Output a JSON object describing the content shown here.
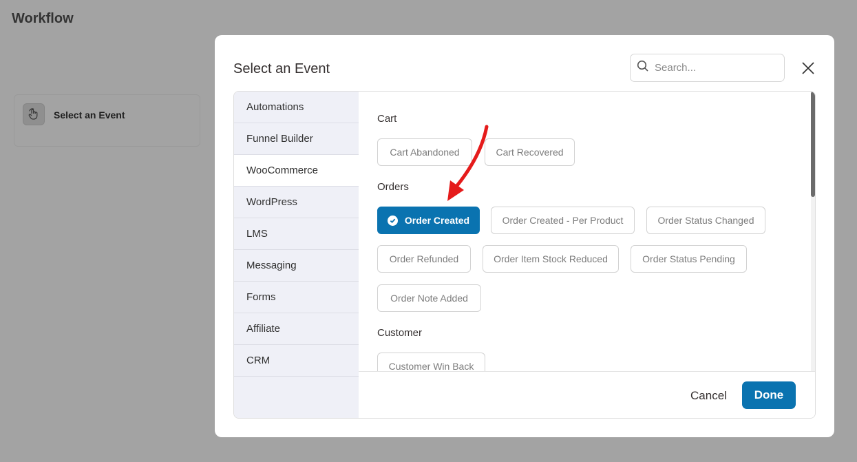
{
  "page": {
    "title": "Workflow"
  },
  "event_card": {
    "label": "Select an Event",
    "icon": "hand-pointer-icon"
  },
  "modal": {
    "title": "Select an Event",
    "search": {
      "placeholder": "Search...",
      "value": ""
    },
    "close_icon": "close-icon"
  },
  "sidebar": {
    "items": [
      {
        "label": "Automations",
        "active": false
      },
      {
        "label": "Funnel Builder",
        "active": false
      },
      {
        "label": "WooCommerce",
        "active": true
      },
      {
        "label": "WordPress",
        "active": false
      },
      {
        "label": "LMS",
        "active": false
      },
      {
        "label": "Messaging",
        "active": false
      },
      {
        "label": "Forms",
        "active": false
      },
      {
        "label": "Affiliate",
        "active": false
      },
      {
        "label": "CRM",
        "active": false
      }
    ]
  },
  "groups": {
    "cart": {
      "label": "Cart",
      "events": [
        "Cart Abandoned",
        "Cart Recovered"
      ]
    },
    "orders": {
      "label": "Orders",
      "events": [
        "Order Created",
        "Order Created - Per Product",
        "Order Status Changed",
        "Order Refunded",
        "Order Item Stock Reduced",
        "Order Status Pending",
        "Order Note Added"
      ],
      "selected": "Order Created"
    },
    "customer": {
      "label": "Customer",
      "events": [
        "Customer Win Back"
      ]
    }
  },
  "footer": {
    "cancel_label": "Cancel",
    "done_label": "Done"
  },
  "colors": {
    "accent": "#0a73b0",
    "overlay": "#a3a3a3",
    "sidebar_bg": "#eff0f7",
    "annotation_arrow": "#e51b1b"
  }
}
